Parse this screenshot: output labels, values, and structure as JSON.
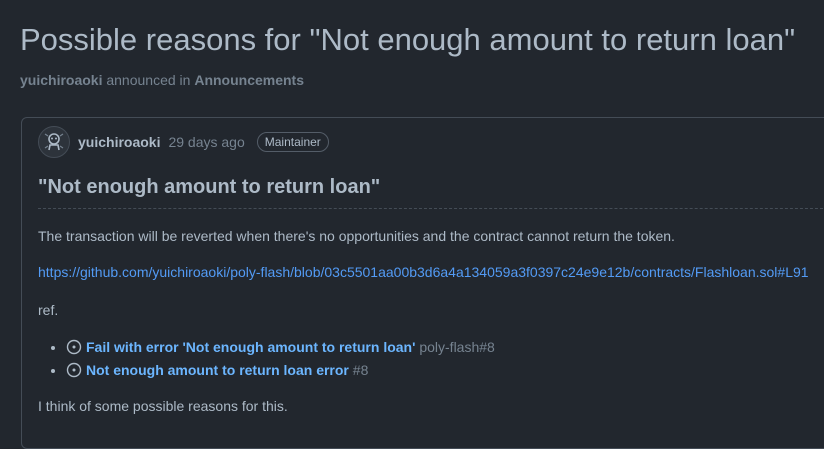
{
  "page": {
    "title": "Possible reasons for \"Not enough amount to return loan\"",
    "author": "yuichiroaoki",
    "announced_text": "announced in",
    "category": "Announcements"
  },
  "post": {
    "author": "yuichiroaoki",
    "time": "29 days ago",
    "role_badge": "Maintainer",
    "edit_hint": "e",
    "heading": "\"Not enough amount to return loan\"",
    "paragraph1": "The transaction will be reverted when there's no opportunities and the contract cannot return the token.",
    "link": "https://github.com/yuichiroaoki/poly-flash/blob/03c5501aa00b3d6a4a134059a3f0397c24e9e12b/contracts/Flashloan.sol#L91",
    "ref_label": "ref.",
    "issues": [
      {
        "title": "Fail with error 'Not enough amount to return loan'",
        "ref": "poly-flash#8"
      },
      {
        "title": "Not enough amount to return loan error",
        "ref": "#8"
      }
    ],
    "last_paragraph": "I think of some possible reasons for this."
  },
  "colors": {
    "background": "#22272e",
    "link": "#539bf5",
    "issue_link": "#6cb6ff",
    "muted": "#768390"
  }
}
